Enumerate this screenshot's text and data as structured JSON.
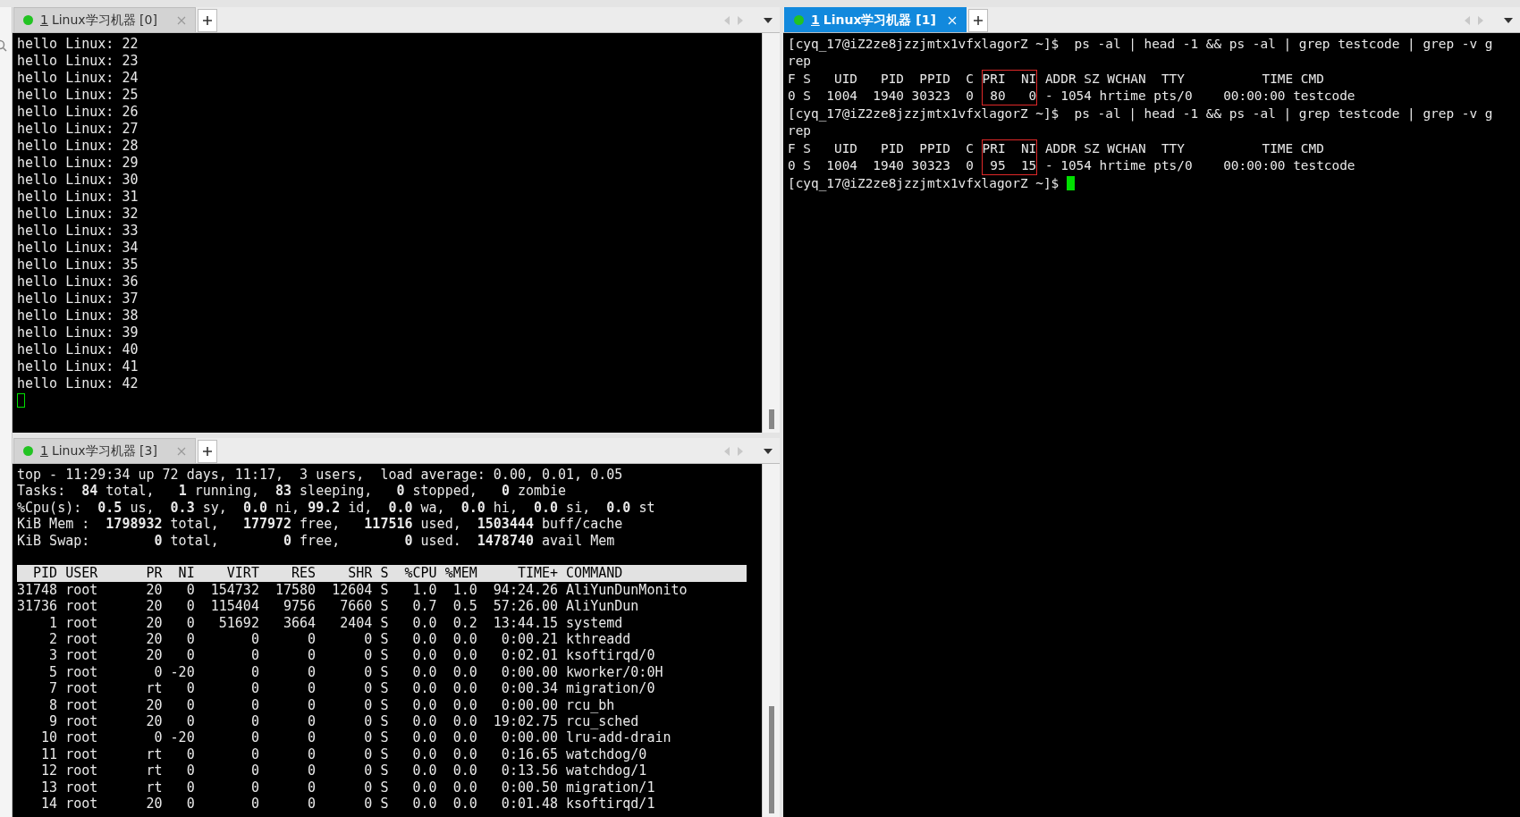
{
  "panes": [
    {
      "tab": {
        "number": "1",
        "title": "Linux学习机器 [0]",
        "selected": false
      },
      "scrollbar": true,
      "lines": [
        {
          "kind": "plain",
          "text": "hello Linux: 22"
        },
        {
          "kind": "plain",
          "text": "hello Linux: 23"
        },
        {
          "kind": "plain",
          "text": "hello Linux: 24"
        },
        {
          "kind": "plain",
          "text": "hello Linux: 25"
        },
        {
          "kind": "plain",
          "text": "hello Linux: 26"
        },
        {
          "kind": "plain",
          "text": "hello Linux: 27"
        },
        {
          "kind": "plain",
          "text": "hello Linux: 28"
        },
        {
          "kind": "plain",
          "text": "hello Linux: 29"
        },
        {
          "kind": "plain",
          "text": "hello Linux: 30"
        },
        {
          "kind": "plain",
          "text": "hello Linux: 31"
        },
        {
          "kind": "plain",
          "text": "hello Linux: 32"
        },
        {
          "kind": "plain",
          "text": "hello Linux: 33"
        },
        {
          "kind": "plain",
          "text": "hello Linux: 34"
        },
        {
          "kind": "plain",
          "text": "hello Linux: 35"
        },
        {
          "kind": "plain",
          "text": "hello Linux: 36"
        },
        {
          "kind": "plain",
          "text": "hello Linux: 37"
        },
        {
          "kind": "plain",
          "text": "hello Linux: 38"
        },
        {
          "kind": "plain",
          "text": "hello Linux: 39"
        },
        {
          "kind": "plain",
          "text": "hello Linux: 40"
        },
        {
          "kind": "plain",
          "text": "hello Linux: 41"
        },
        {
          "kind": "plain",
          "text": "hello Linux: 42"
        },
        {
          "kind": "cursor"
        }
      ]
    },
    {
      "tab": {
        "number": "1",
        "title": "Linux学习机器 [3]",
        "selected": false
      },
      "scrollbar": true,
      "lines": [
        {
          "kind": "plain",
          "text": "top - 11:29:34 up 72 days, 11:17,  3 users,  load average: 0.00, 0.01, 0.05"
        },
        {
          "kind": "plain",
          "text": "Tasks:  **84** total,   **1** running,  **83** sleeping,   **0** stopped,   **0** zombie"
        },
        {
          "kind": "plain",
          "text": "%Cpu(s):  **0.5** us,  **0.3** sy,  **0.0** ni, **99.2** id,  **0.0** wa,  **0.0** hi,  **0.0** si,  **0.0** st"
        },
        {
          "kind": "plain",
          "text": "KiB Mem :  **1798932** total,   **177972** free,   **117516** used,  **1503444** buff/cache"
        },
        {
          "kind": "plain",
          "text": "KiB Swap:        **0** total,        **0** free,        **0** used.  **1478740** avail Mem"
        }
      ],
      "table_header": "  PID USER      PR  NI    VIRT    RES    SHR S  %CPU %MEM     TIME+ COMMAND",
      "table_rows": [
        "31748 root      20   0  154732  17580  12604 S   1.0  1.0  94:24.26 AliYunDunMonito",
        "31736 root      20   0  115404   9756   7660 S   0.7  0.5  57:26.00 AliYunDun",
        "    1 root      20   0   51692   3664   2404 S   0.0  0.2  13:44.15 systemd",
        "    2 root      20   0       0      0      0 S   0.0  0.0   0:00.21 kthreadd",
        "    3 root      20   0       0      0      0 S   0.0  0.0   0:02.01 ksoftirqd/0",
        "    5 root       0 -20       0      0      0 S   0.0  0.0   0:00.00 kworker/0:0H",
        "    7 root      rt   0       0      0      0 S   0.0  0.0   0:00.34 migration/0",
        "    8 root      20   0       0      0      0 S   0.0  0.0   0:00.00 rcu_bh",
        "    9 root      20   0       0      0      0 S   0.0  0.0  19:02.75 rcu_sched",
        "   10 root       0 -20       0      0      0 S   0.0  0.0   0:00.00 lru-add-drain",
        "   11 root      rt   0       0      0      0 S   0.0  0.0   0:16.65 watchdog/0",
        "   12 root      rt   0       0      0      0 S   0.0  0.0   0:13.56 watchdog/1",
        "   13 root      rt   0       0      0      0 S   0.0  0.0   0:00.50 migration/1",
        "   14 root      20   0       0      0      0 S   0.0  0.0   0:01.48 ksoftirqd/1"
      ]
    },
    {
      "tab": {
        "number": "1",
        "title": "Linux学习机器 [1]",
        "selected": true
      },
      "scrollbar": false,
      "lines": [
        {
          "kind": "plain",
          "text": "[cyq_17@iZ2ze8jzzjmtx1vfxlagorZ ~]$  ps -al | head -1 && ps -al | grep testcode | grep -v g"
        },
        {
          "kind": "plain",
          "text": "rep"
        },
        {
          "kind": "boxed",
          "pre": "F S   UID   PID  PPID  C ",
          "boxed": "PRI  NI",
          "post": " ADDR SZ WCHAN  TTY          TIME CMD",
          "box_top": true,
          "box_bottom": false
        },
        {
          "kind": "boxed",
          "pre": "0 S  1004  1940 30323  0 ",
          "boxed": " 80   0",
          "post": " - 1054 hrtime pts/0    00:00:00 testcode",
          "box_top": false,
          "box_bottom": true
        },
        {
          "kind": "plain",
          "text": "[cyq_17@iZ2ze8jzzjmtx1vfxlagorZ ~]$  ps -al | head -1 && ps -al | grep testcode | grep -v g"
        },
        {
          "kind": "plain",
          "text": "rep"
        },
        {
          "kind": "boxed",
          "pre": "F S   UID   PID  PPID  C ",
          "boxed": "PRI  NI",
          "post": " ADDR SZ WCHAN  TTY          TIME CMD",
          "box_top": true,
          "box_bottom": false
        },
        {
          "kind": "boxed",
          "pre": "0 S  1004  1940 30323  0 ",
          "boxed": " 95  15",
          "post": " - 1054 hrtime pts/0    00:00:00 testcode",
          "box_top": false,
          "box_bottom": true
        },
        {
          "kind": "prompt",
          "text": "[cyq_17@iZ2ze8jzzjmtx1vfxlagorZ ~]$ "
        }
      ]
    }
  ]
}
